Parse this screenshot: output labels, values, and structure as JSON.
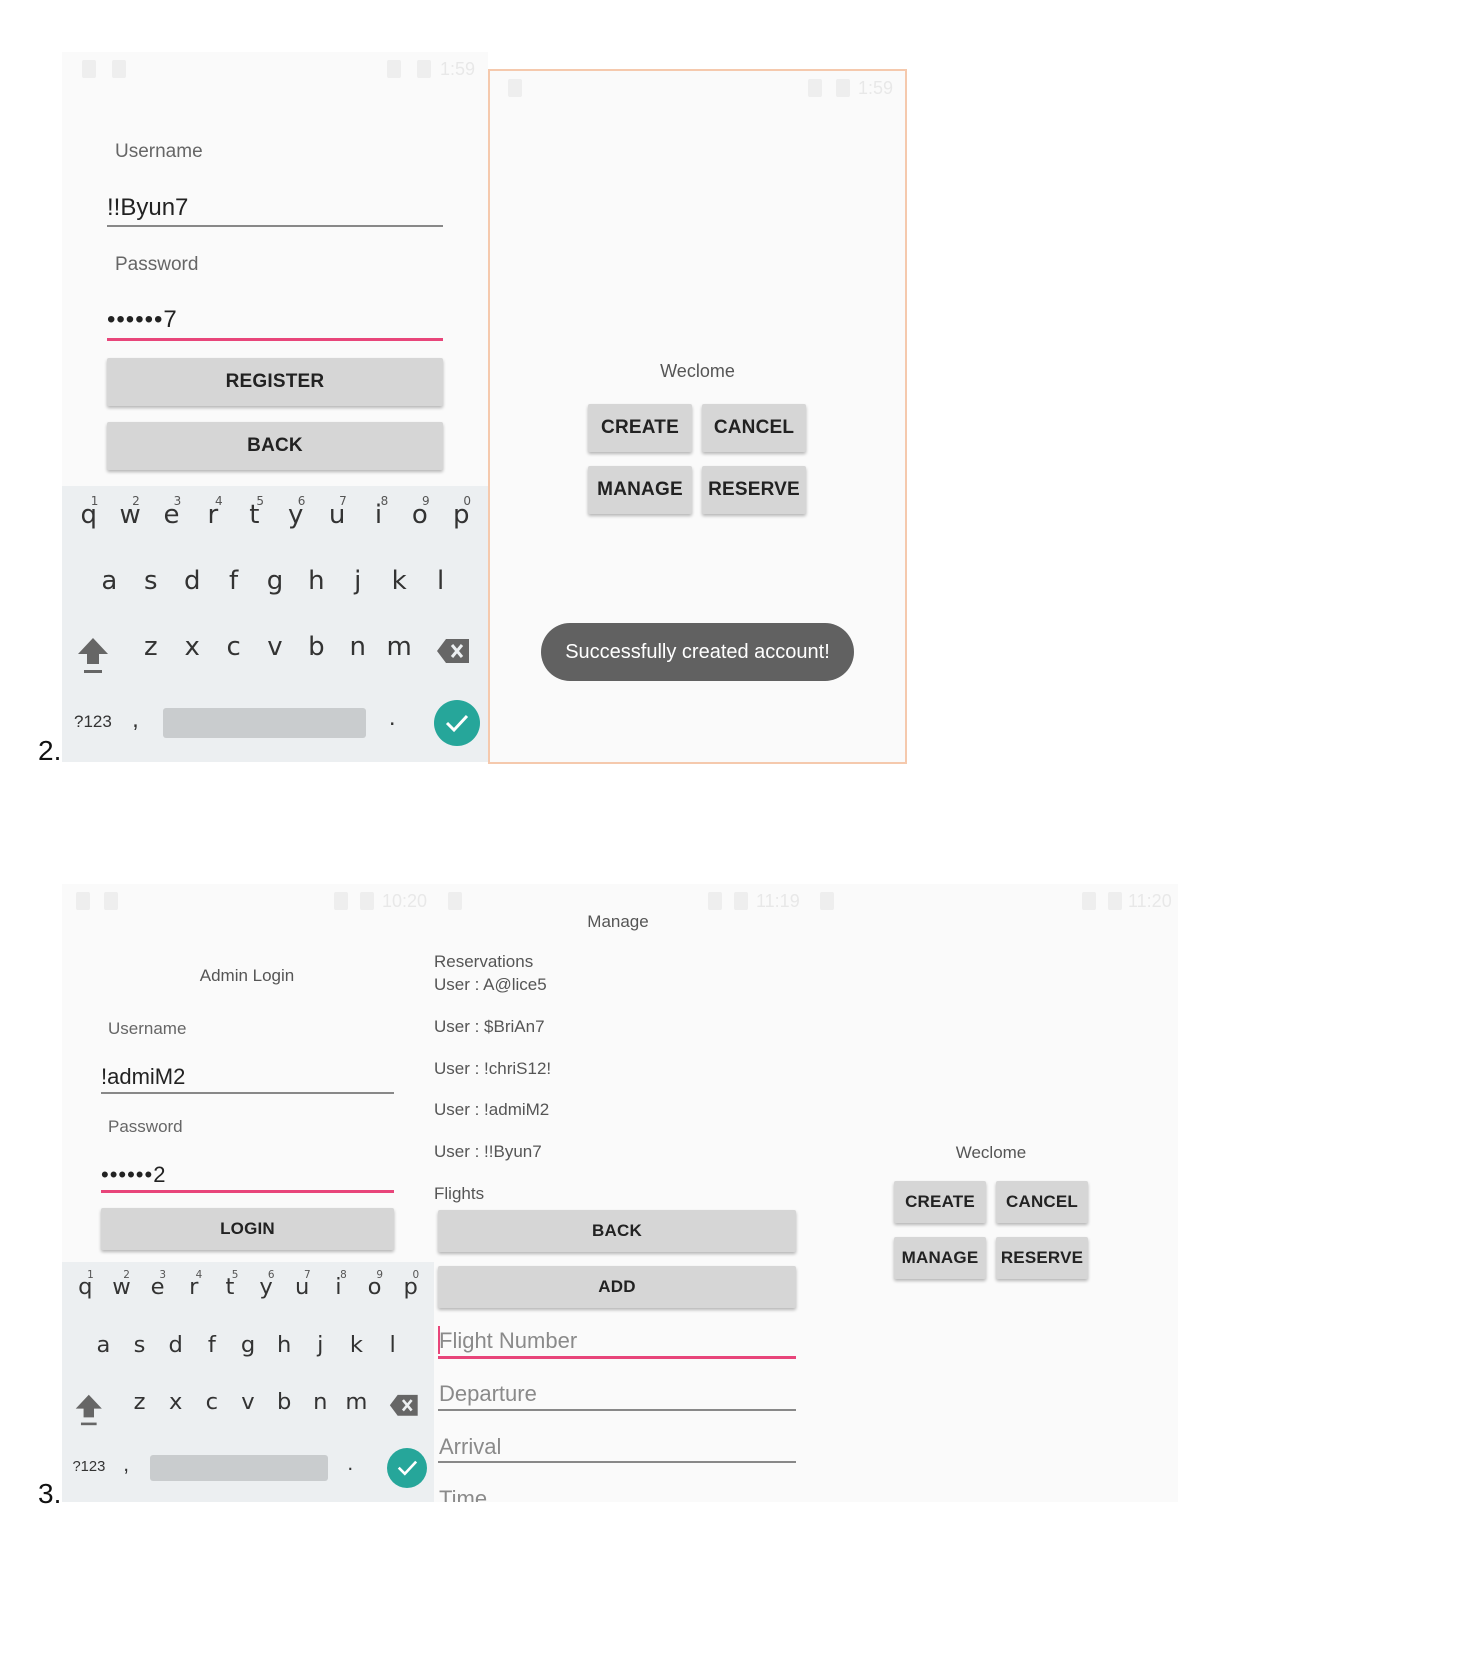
{
  "step2": {
    "number": "2.",
    "register": {
      "username_label": "Username",
      "username_value": "!!Byun7",
      "password_label": "Password",
      "password_value": "••••••7",
      "register_button": "REGISTER",
      "back_button": "BACK"
    },
    "welcome": {
      "title": "Weclome",
      "create": "CREATE",
      "cancel": "CANCEL",
      "manage": "MANAGE",
      "reserve": "RESERVE",
      "toast": "Successfully created account!"
    }
  },
  "step3": {
    "number": "3.",
    "admin": {
      "title": "Admin Login",
      "username_label": "Username",
      "username_value": "!admiM2",
      "password_label": "Password",
      "password_value": "••••••2",
      "login_button": "LOGIN"
    },
    "manage": {
      "title": "Manage",
      "reservations_header": "Reservations",
      "users": [
        "User : A@lice5",
        "User : $BriAn7",
        "User : !chriS12!",
        "User : !admiM2",
        "User : !!Byun7"
      ],
      "flights_header": "Flights",
      "back_button": "BACK",
      "add_button": "ADD",
      "flight_number_placeholder": "Flight Number",
      "departure_placeholder": "Departure",
      "arrival_placeholder": "Arrival",
      "time_placeholder": "Time"
    },
    "welcome": {
      "title": "Weclome",
      "create": "CREATE",
      "cancel": "CANCEL",
      "manage": "MANAGE",
      "reserve": "RESERVE"
    }
  },
  "keyboard": {
    "row1": [
      "q",
      "w",
      "e",
      "r",
      "t",
      "y",
      "u",
      "i",
      "o",
      "p"
    ],
    "row1_hints": [
      "1",
      "2",
      "3",
      "4",
      "5",
      "6",
      "7",
      "8",
      "9",
      "0"
    ],
    "row2": [
      "a",
      "s",
      "d",
      "f",
      "g",
      "h",
      "j",
      "k",
      "l"
    ],
    "row3": [
      "z",
      "x",
      "c",
      "v",
      "b",
      "n",
      "m"
    ],
    "symbols": "?123",
    "comma": ",",
    "period": ".",
    "shift_icon": "shift-arrow-icon",
    "backspace_icon": "backspace-icon",
    "enter_icon": "checkmark-icon"
  },
  "status_time_values": [
    "1:59",
    "1:59",
    "10:20",
    "11:19",
    "11:20"
  ],
  "colors": {
    "accent_underline": "#e8457a",
    "enter_key": "#26a69a",
    "button_bg": "#d6d6d6",
    "toast_bg": "#616161",
    "frame_border": "#f5c9ad"
  }
}
